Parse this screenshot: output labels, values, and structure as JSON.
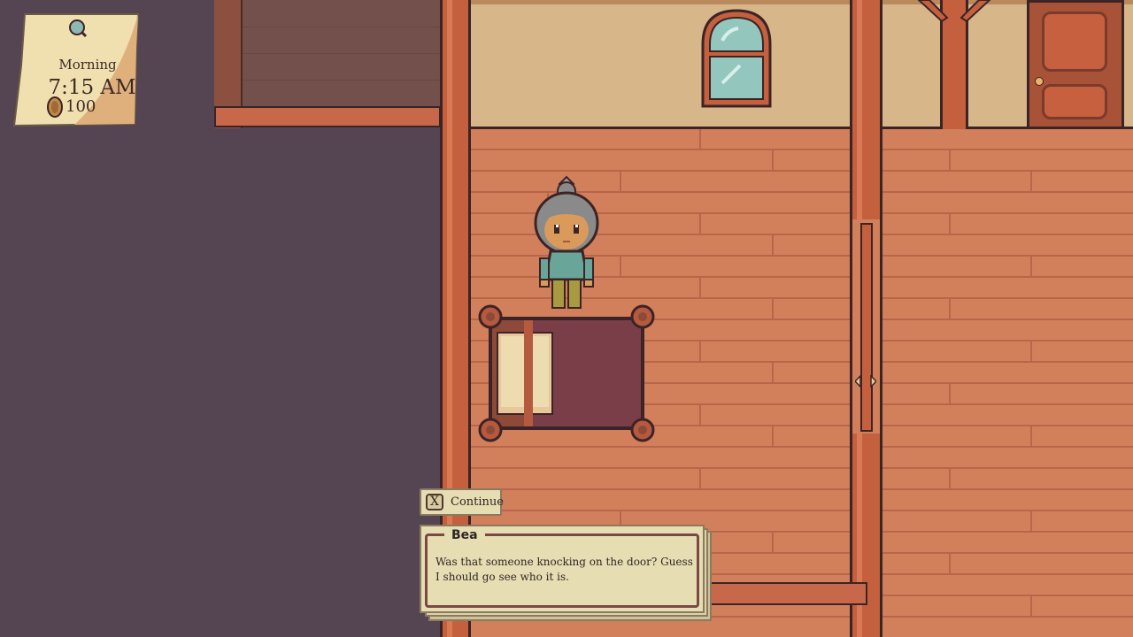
{
  "hud": {
    "period": "Morning",
    "time": "7:15 AM",
    "money": "100",
    "icons": [
      "magnifier-pin-icon",
      "coin-icon"
    ]
  },
  "prompt": {
    "key": "X",
    "label": "Continue"
  },
  "dialog": {
    "speaker": "Bea",
    "text": "Was that someone knocking on the door? Guess I should go see who it is."
  },
  "colors": {
    "void": "#554552",
    "floor": "#d2805c",
    "wall": "#d7b78a",
    "wood": "#c5603f",
    "outline": "#3c2426",
    "paper": "#e7ddb3"
  }
}
